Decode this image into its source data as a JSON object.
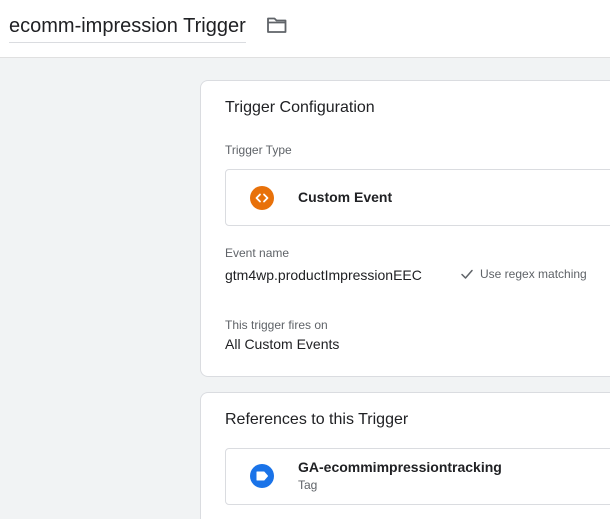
{
  "header": {
    "title": "ecomm-impression Trigger",
    "folder_icon": "folder-icon"
  },
  "config": {
    "title": "Trigger Configuration",
    "type_label": "Trigger Type",
    "type": {
      "name": "Custom Event",
      "icon": "code-brackets-icon",
      "icon_color": "#e8710a"
    },
    "event_name_label": "Event name",
    "event_name": "gtm4wp.productImpressionEEC",
    "regex_label": "Use regex matching",
    "fires_on_label": "This trigger fires on",
    "fires_on": "All Custom Events"
  },
  "references": {
    "title": "References to this Trigger",
    "items": [
      {
        "name": "GA-ecommimpressiontracking",
        "kind": "Tag",
        "icon": "tag-icon",
        "icon_color": "#1a73e8"
      }
    ]
  }
}
